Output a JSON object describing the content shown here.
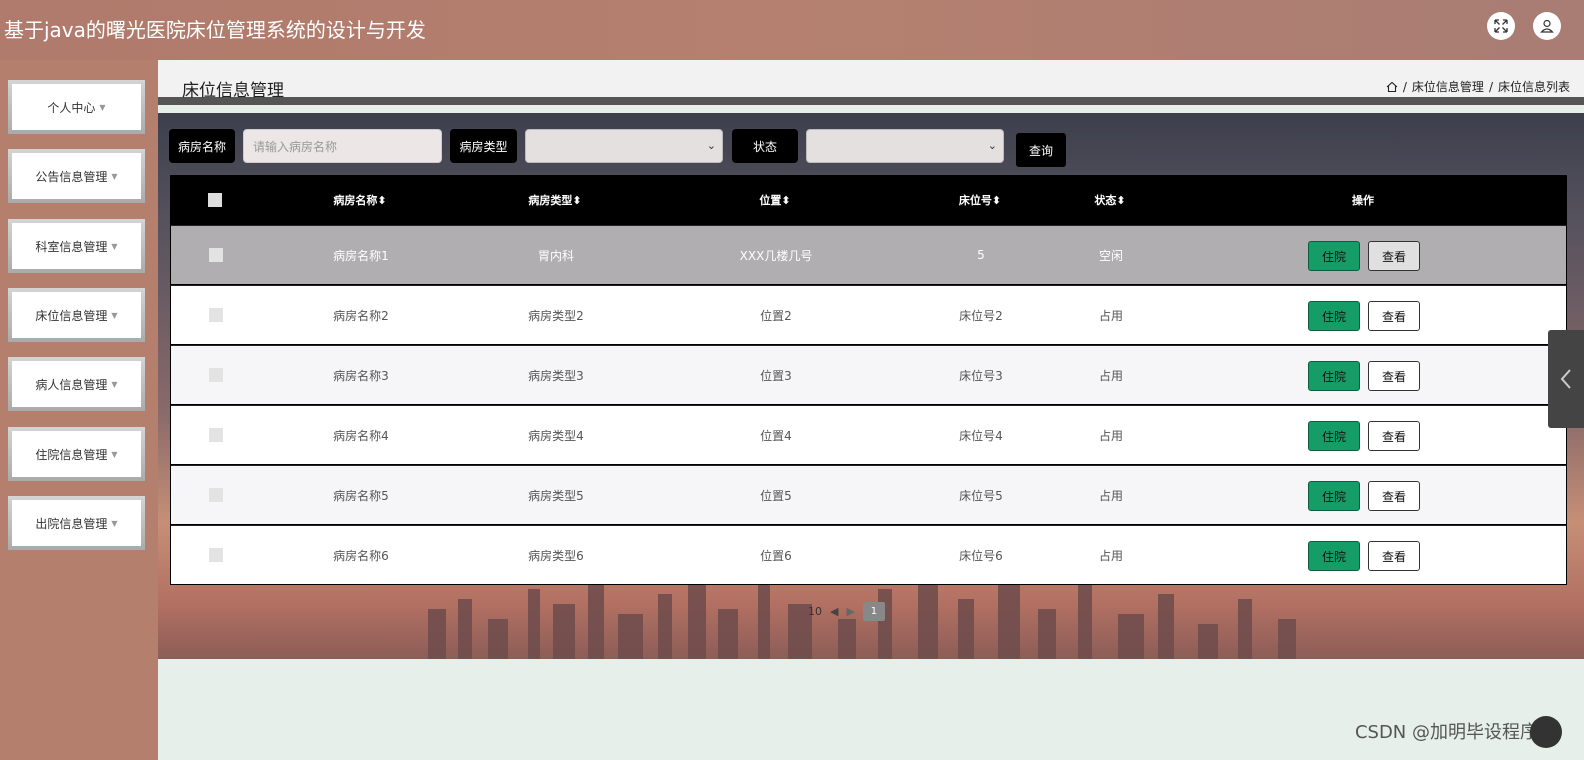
{
  "app": {
    "title": "基于java的曙光医院床位管理系统的设计与开发"
  },
  "header": {
    "fullscreen_icon": "expand-icon",
    "user_icon": "user-icon"
  },
  "sidebar": {
    "items": [
      {
        "label": "个人中心"
      },
      {
        "label": "公告信息管理"
      },
      {
        "label": "科室信息管理"
      },
      {
        "label": "床位信息管理"
      },
      {
        "label": "病人信息管理"
      },
      {
        "label": "住院信息管理"
      },
      {
        "label": "出院信息管理"
      }
    ]
  },
  "page": {
    "title": "床位信息管理",
    "breadcrumb": [
      "床位信息管理",
      "床位信息列表"
    ]
  },
  "search": {
    "room_name_label": "病房名称",
    "room_name_placeholder": "请输入病房名称",
    "room_type_label": "病房类型",
    "status_label": "状态",
    "query_button": "查询"
  },
  "table": {
    "headers": [
      "病房名称",
      "病房类型",
      "位置",
      "床位号",
      "状态",
      "操作"
    ],
    "sort_glyph": "⬍",
    "rows": [
      {
        "name": "病房名称1",
        "type": "胃内科",
        "location": "XXX几楼几号",
        "bed": "5",
        "status": "空闲"
      },
      {
        "name": "病房名称2",
        "type": "病房类型2",
        "location": "位置2",
        "bed": "床位号2",
        "status": "占用"
      },
      {
        "name": "病房名称3",
        "type": "病房类型3",
        "location": "位置3",
        "bed": "床位号3",
        "status": "占用"
      },
      {
        "name": "病房名称4",
        "type": "病房类型4",
        "location": "位置4",
        "bed": "床位号4",
        "status": "占用"
      },
      {
        "name": "病房名称5",
        "type": "病房类型5",
        "location": "位置5",
        "bed": "床位号5",
        "status": "占用"
      },
      {
        "name": "病房名称6",
        "type": "病房类型6",
        "location": "位置6",
        "bed": "床位号6",
        "status": "占用"
      }
    ],
    "admit_button": "住院",
    "view_button": "查看"
  },
  "pagination": {
    "page_size": "10",
    "current_page": "1"
  },
  "watermark": "CSDN @加明毕设程序"
}
